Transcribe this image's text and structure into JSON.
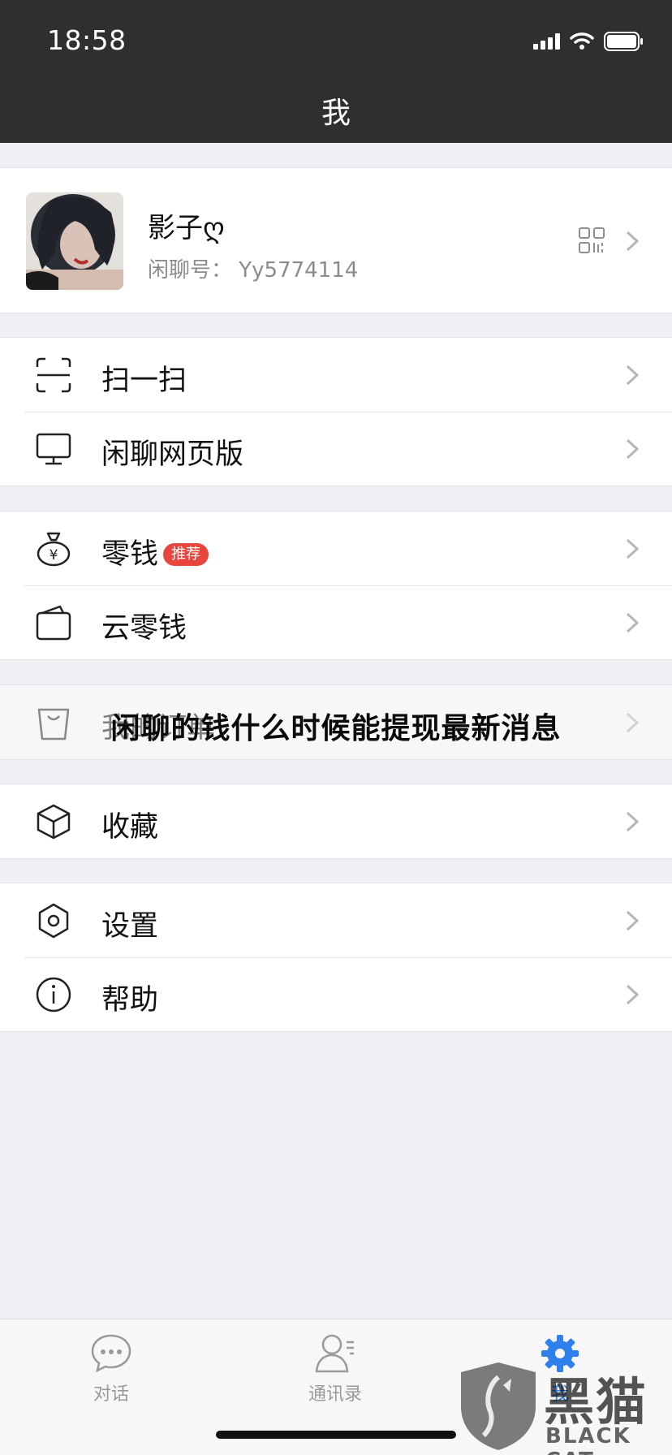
{
  "status_bar": {
    "time": "18:58"
  },
  "nav": {
    "title": "我"
  },
  "profile": {
    "nickname": "影子ღ",
    "id_label": "闲聊号：",
    "id_value": "Yy5774114"
  },
  "menu": {
    "scan": "扫一扫",
    "web": "闲聊网页版",
    "wallet": "零钱",
    "wallet_badge": "推荐",
    "cloud_wallet": "云零钱",
    "orders": "我的订单",
    "favorites": "收藏",
    "settings": "设置",
    "help": "帮助"
  },
  "overlay": {
    "caption": "闲聊的钱什么时候能提现最新消息"
  },
  "tabs": [
    {
      "label": "对话",
      "icon": "chat-icon"
    },
    {
      "label": "通讯录",
      "icon": "contacts-icon"
    },
    {
      "label": "我",
      "icon": "gear-icon"
    }
  ],
  "watermark": {
    "brand": "黑猫",
    "brand_en": "BLACK CAT"
  },
  "colors": {
    "header_bg": "#2f2f2f",
    "page_bg": "#f0f0f4",
    "badge": "#e8453c",
    "active_tab": "#2f80ed"
  }
}
